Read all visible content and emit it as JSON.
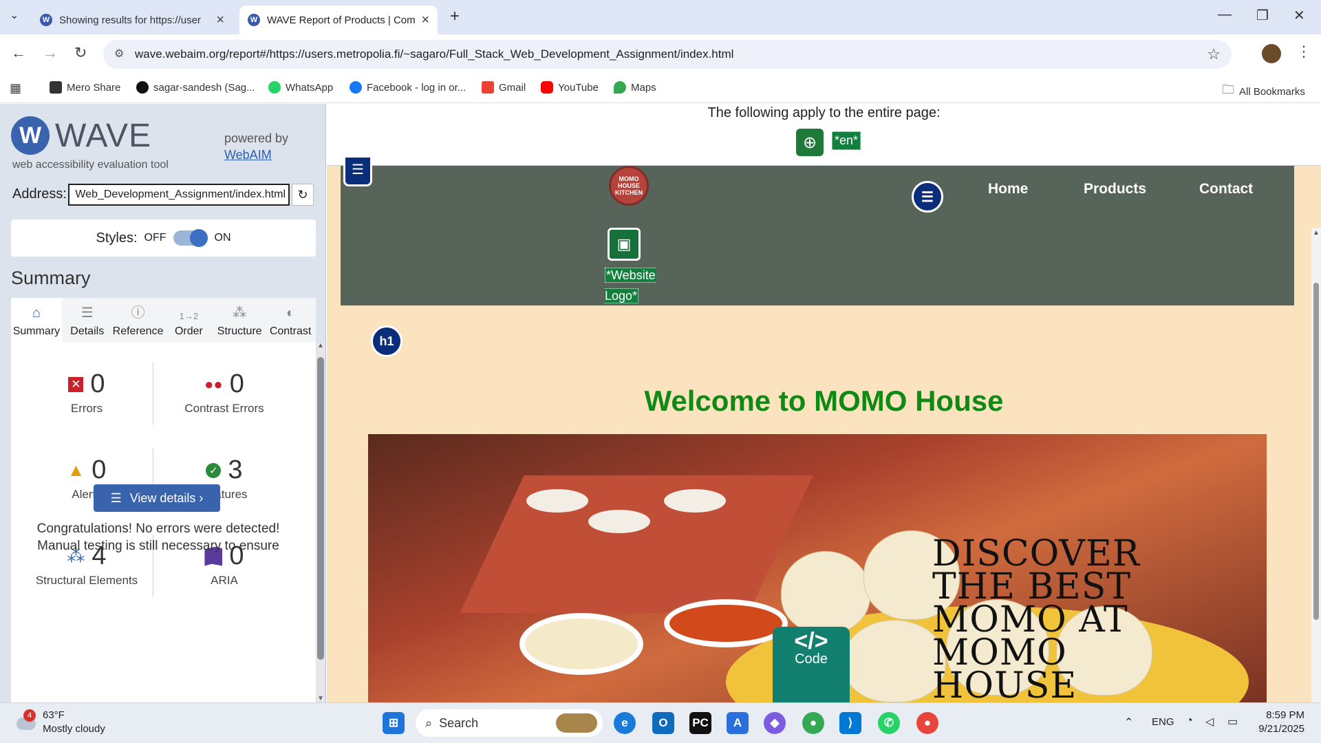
{
  "browser": {
    "tabs": [
      {
        "title": "Showing results for https://user",
        "active": false
      },
      {
        "title": "WAVE Report of Products | Com",
        "active": true
      }
    ],
    "url": "wave.webaim.org/report#/https://users.metropolia.fi/~sagaro/Full_Stack_Web_Development_Assignment/index.html",
    "bookmarks": [
      "Mero Share",
      "sagar-sandesh (Sag...",
      "WhatsApp",
      "Facebook - log in or...",
      "Gmail",
      "YouTube",
      "Maps"
    ],
    "all_bookmarks": "All Bookmarks"
  },
  "wave": {
    "logo_text": "WAVE",
    "subtitle": "web accessibility evaluation tool",
    "powered_by": "powered by",
    "webaim": "WebAIM",
    "address_label": "Address:",
    "address_value": "Web_Development_Assignment/index.html",
    "styles_label": "Styles:",
    "styles_off": "OFF",
    "styles_on": "ON",
    "summary_title": "Summary",
    "tabs": [
      "Summary",
      "Details",
      "Reference",
      "Order",
      "Structure",
      "Contrast"
    ],
    "stats": {
      "errors": {
        "value": "0",
        "label": "Errors"
      },
      "contrast": {
        "value": "0",
        "label": "Contrast Errors"
      },
      "alerts": {
        "value": "0",
        "label": "Alerts"
      },
      "features": {
        "value": "3",
        "label": "Features"
      },
      "structural": {
        "value": "4",
        "label": "Structural Elements"
      },
      "aria": {
        "value": "0",
        "label": "ARIA"
      }
    },
    "view_details": "View details ›",
    "congrats": "Congratulations! No errors were detected! Manual testing is still necessary to ensure compliance and optimal accessibility."
  },
  "page": {
    "apply_text": "The following apply to the entire page:",
    "lang_tag": "*en*",
    "nav_links": [
      "Home",
      "Products",
      "Contact"
    ],
    "logo_alt": "*Website Logo*",
    "logo_text": "MOMO HOUSE KITCHEN",
    "h1_badge": "h1",
    "welcome": "Welcome to MOMO House",
    "hero_text": "DISCOVER THE BEST MOMO AT MOMO HOUSE",
    "code_badge": "Code"
  },
  "taskbar": {
    "weather_temp": "63°F",
    "weather_desc": "Mostly cloudy",
    "weather_badge": "4",
    "search": "Search",
    "lang": "ENG",
    "time": "8:59 PM",
    "date": "9/21/2025"
  }
}
